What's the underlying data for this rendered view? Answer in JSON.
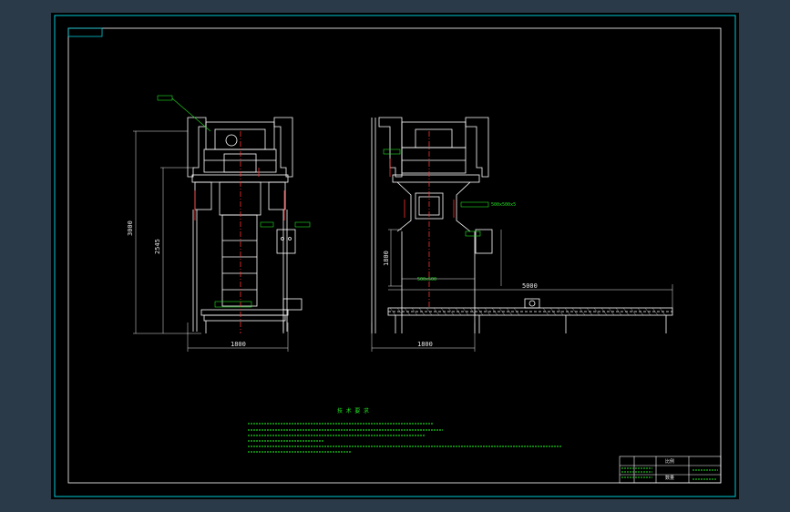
{
  "colors": {
    "background": "#2b3a48",
    "sheet": "#000000",
    "frame": "#00c8d8",
    "outline": "#ffffff",
    "dimension": "#e8e8e8",
    "annotation": "#22e022",
    "centerline": "#ff3030",
    "hatch": "#cccccc"
  },
  "front_view": {
    "overall_height": "3000",
    "inner_height": "2545",
    "base_width": "1800"
  },
  "side_view": {
    "left_height": "1800",
    "base_width": "1800",
    "conveyor_length": "5000",
    "opening_label": "500x500",
    "top_label": "500x500x5"
  },
  "notes": {
    "title": "技 术 要 求"
  },
  "title_block": {
    "label_a": "比例",
    "label_b": "数量"
  }
}
